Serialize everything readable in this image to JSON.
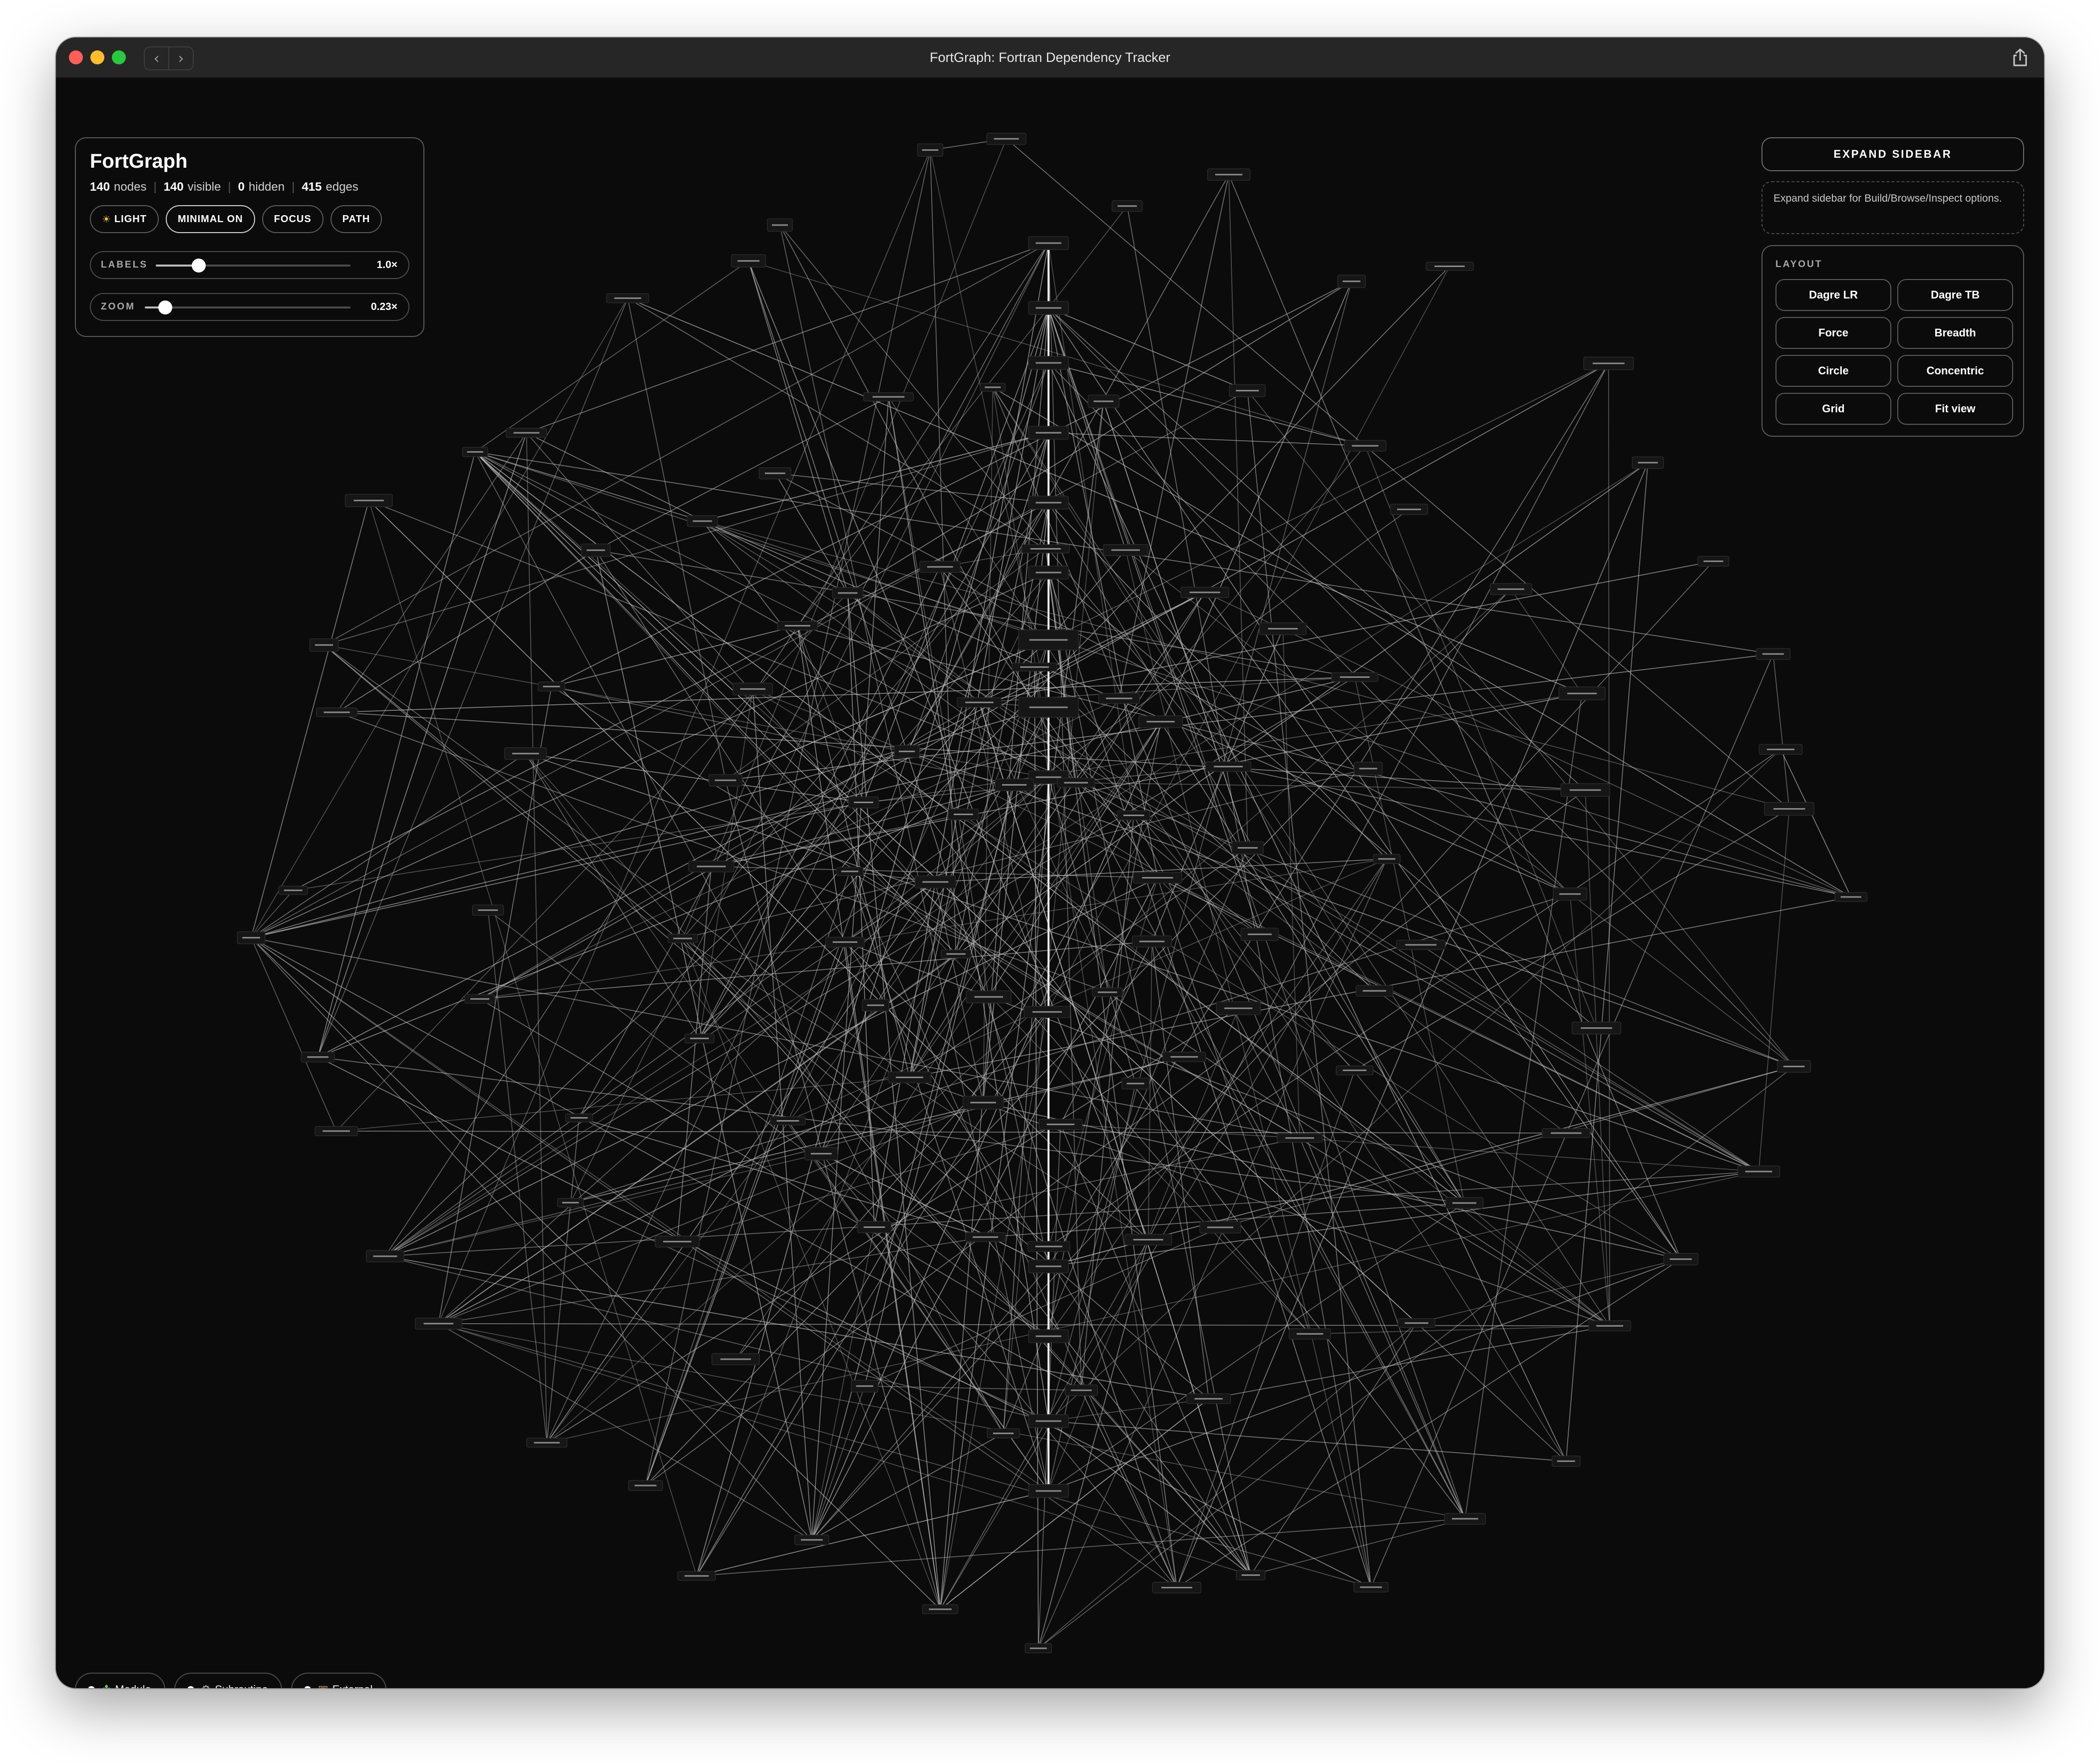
{
  "window": {
    "title": "FortGraph: Fortran Dependency Tracker"
  },
  "app": {
    "name": "FortGraph",
    "stats": {
      "nodes": "140",
      "nodes_label": "nodes",
      "visible": "140",
      "visible_label": "visible",
      "hidden": "0",
      "hidden_label": "hidden",
      "edges": "415",
      "edges_label": "edges"
    },
    "toggles": {
      "theme": "LIGHT",
      "minimal": "MINIMAL ON",
      "focus": "FOCUS",
      "path": "PATH"
    },
    "sliders": {
      "labels": {
        "label": "LABELS",
        "value": "1.0×",
        "level": 0.22
      },
      "zoom": {
        "label": "ZOOM",
        "value": "0.23×",
        "level": 0.1
      }
    }
  },
  "sidebar": {
    "expand_label": "EXPAND SIDEBAR",
    "hint": "Expand sidebar for Build/Browse/Inspect options.",
    "layout": {
      "title": "LAYOUT",
      "buttons": [
        "Dagre LR",
        "Dagre TB",
        "Force",
        "Breadth",
        "Circle",
        "Concentric",
        "Grid",
        "Fit view"
      ]
    }
  },
  "legend": {
    "module": {
      "label": "Module",
      "icon": "puzzle-icon"
    },
    "subroutine": {
      "label": "Subroutine",
      "icon": "gear-icon"
    },
    "external": {
      "label": "External",
      "icon": "package-icon"
    }
  },
  "graph": {
    "background": "#0b0b0b",
    "edge_color": "#bfbfbf",
    "node_fill": "#161616",
    "node_stroke": "#2a2a2a",
    "node_count": 140,
    "edge_count": 415
  },
  "colors": {
    "panel_border": "#5a5a5a",
    "text": "#ffffff",
    "traffic_red": "#ff5f57",
    "traffic_yellow": "#febc2e",
    "traffic_green": "#28c840"
  }
}
